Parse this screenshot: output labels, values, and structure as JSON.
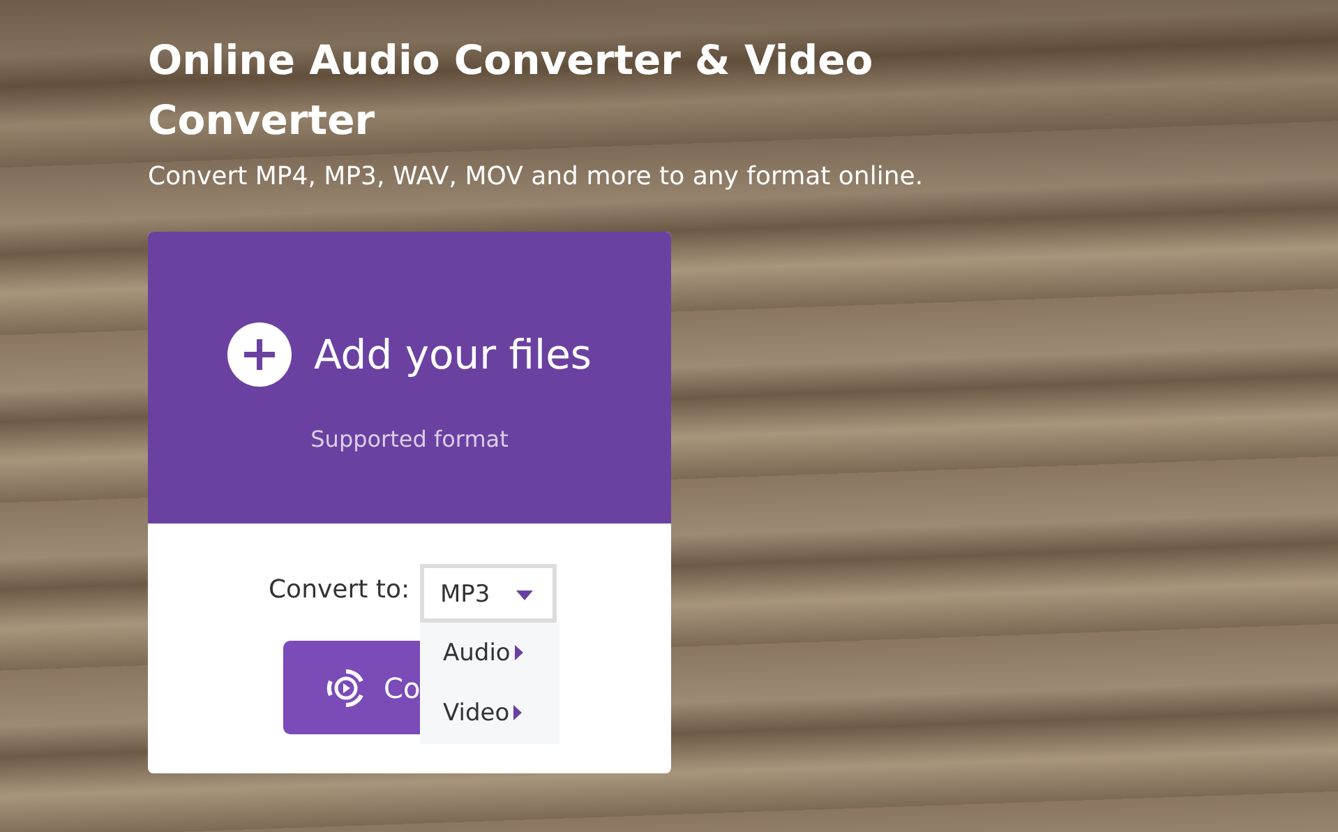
{
  "header": {
    "title": "Online Audio Converter & Video Converter",
    "subtitle": "Convert MP4, MP3, WAV, MOV and more to any format online."
  },
  "upload": {
    "label": "Add your files",
    "hint": "Supported format"
  },
  "convert": {
    "label": "Convert to:",
    "value": "MP3",
    "expanded": true,
    "menu": [
      {
        "label": "Audio"
      },
      {
        "label": "Video"
      }
    ],
    "button": "Co"
  }
}
